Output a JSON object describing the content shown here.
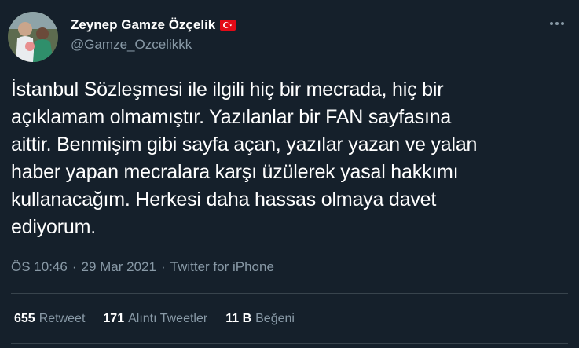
{
  "author": {
    "display_name": "Zeynep Gamze Özçelik",
    "handle": "@Gamze_Ozcelikkk",
    "flag_icon": "turkey-flag-icon"
  },
  "tweet": {
    "text": "İstanbul Sözleşmesi ile ilgili hiç bir mecrada, hiç bir\naçıklamam olmamıştır. Yazılanlar bir FAN sayfasına\naittir. Benmişim gibi sayfa açan, yazılar yazan ve yalan\nhaber yapan mecralara karşı üzülerek yasal hakkımı\nkullanacağım. Herkesi daha hassas olmaya davet\nediyorum.",
    "time": "ÖS 10:46",
    "separator": "·",
    "date": "29 Mar 2021",
    "source": "Twitter for iPhone"
  },
  "stats": [
    {
      "count": "655",
      "label": "Retweet"
    },
    {
      "count": "171",
      "label": "Alıntı Tweetler"
    },
    {
      "count": "11 B",
      "label": "Beğeni"
    }
  ],
  "colors": {
    "background": "#15202b",
    "text": "#ffffff",
    "secondary": "#8899a6",
    "divider": "#38444d",
    "flag_red": "#e30a17"
  }
}
